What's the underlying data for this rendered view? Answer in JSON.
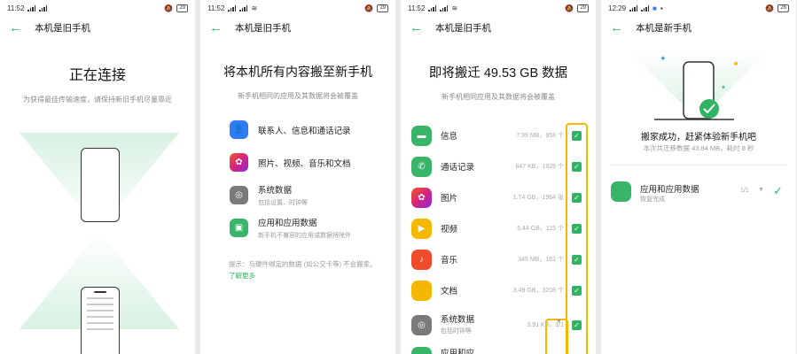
{
  "colors": {
    "accent": "#2fb464",
    "highlight": "#f5b800",
    "bg": "#e9e9e9"
  },
  "panel1": {
    "status": {
      "time": "11:52",
      "battery": "29"
    },
    "appbar_title": "本机是旧手机",
    "title": "正在连接",
    "subtitle": "为获得最佳传输速度，请保持新旧手机尽量靠近"
  },
  "panel2": {
    "status": {
      "time": "11:52",
      "battery": "29"
    },
    "appbar_title": "本机是旧手机",
    "title": "将本机所有内容搬至新手机",
    "subtitle": "新手机相同的应用及其数据将会被覆盖",
    "items": [
      {
        "label": "联系人、信息和通话记录",
        "sub": "",
        "icon": "contacts-icon",
        "color": "#2f7cf6"
      },
      {
        "label": "照片、视频、音乐和文档",
        "sub": "",
        "icon": "gallery-icon",
        "color": "#e0327a"
      },
      {
        "label": "系统数据",
        "sub": "包括设置、时钟等",
        "icon": "system-icon",
        "color": "#777777"
      },
      {
        "label": "应用和应用数据",
        "sub": "新手机不兼容的应用或数据将除外",
        "icon": "android-icon",
        "color": "#39b56a"
      }
    ],
    "note_text": "提示：与硬件绑定的数据 (如公交卡等) 不会搬家。",
    "note_link": "了解更多"
  },
  "panel3": {
    "status": {
      "time": "11:52",
      "battery": "29"
    },
    "appbar_title": "本机是旧手机",
    "title": "即将搬迁 49.53 GB 数据",
    "subtitle": "新手机相同应用及其数据将会被覆盖",
    "rows": [
      {
        "name": "信息",
        "size": "7.99 MB，958 个",
        "icon": "message-icon",
        "color": "#39b56a"
      },
      {
        "name": "通话记录",
        "size": "847 KB，1928 个",
        "icon": "phone-icon",
        "color": "#39b56a"
      },
      {
        "name": "图片",
        "size": "1.74 GB，1964 张",
        "icon": "photos-icon",
        "color": "#e0327a"
      },
      {
        "name": "视频",
        "size": "5.44 GB，115 个",
        "icon": "video-icon",
        "color": "#f5b800"
      },
      {
        "name": "音乐",
        "size": "345 MB，161 个",
        "icon": "music-icon",
        "color": "#f04b2a"
      },
      {
        "name": "文档",
        "size": "3.49 GB，3208 个",
        "icon": "docs-icon",
        "color": "#f5b800"
      },
      {
        "name": "系统数据",
        "size": "3.91 KB，1/1",
        "sub": "包括时钟等",
        "icon": "system-icon",
        "color": "#777777"
      },
      {
        "name": "应用和应",
        "size": "",
        "icon": "android-icon",
        "color": "#39b56a"
      }
    ]
  },
  "panel4": {
    "status": {
      "time": "12:29",
      "battery": "26"
    },
    "appbar_title": "本机是新手机",
    "title": "搬家成功，赶紧体验新手机吧",
    "subtitle": "本次共迁移数据 43.84 MB，耗时 8 秒",
    "row": {
      "name": "应用和应用数据",
      "sub": "恢复完成",
      "count": "1/1"
    }
  }
}
